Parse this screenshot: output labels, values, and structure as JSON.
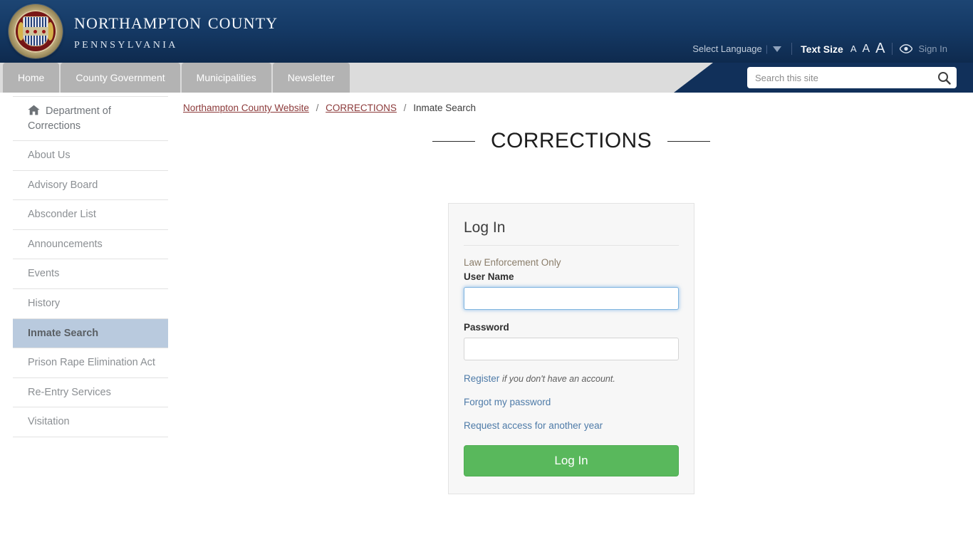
{
  "header": {
    "brand_line1": "Northampton County",
    "brand_line2": "Pennsylvania",
    "seal_alt": "county-seal",
    "select_language": "Select Language",
    "text_size_label": "Text Size",
    "text_size_small": "A",
    "text_size_medium": "A",
    "text_size_large": "A",
    "sign_in": "Sign In"
  },
  "nav": {
    "tabs": [
      {
        "label": "Home"
      },
      {
        "label": "County Government"
      },
      {
        "label": "Municipalities"
      },
      {
        "label": "Newsletter"
      }
    ],
    "search_placeholder": "Search this site",
    "search_value": ""
  },
  "breadcrumb": {
    "items": [
      {
        "label": "Northampton County Website",
        "link": true
      },
      {
        "label": "CORRECTIONS",
        "link": true
      },
      {
        "label": "Inmate Search",
        "link": false
      }
    ],
    "separator": "/"
  },
  "page": {
    "title": "CORRECTIONS"
  },
  "sidebar": {
    "items": [
      {
        "label": "Department of Corrections",
        "icon": "home-icon",
        "active": false
      },
      {
        "label": "About Us",
        "active": false
      },
      {
        "label": "Advisory Board",
        "active": false
      },
      {
        "label": "Absconder List",
        "active": false
      },
      {
        "label": "Announcements",
        "active": false
      },
      {
        "label": "Events",
        "active": false
      },
      {
        "label": "History",
        "active": false
      },
      {
        "label": "Inmate Search",
        "active": true
      },
      {
        "label": "Prison Rape Elimination Act",
        "active": false
      },
      {
        "label": "Re-Entry Services",
        "active": false
      },
      {
        "label": "Visitation",
        "active": false
      }
    ]
  },
  "login": {
    "heading": "Log In",
    "notice": "Law Enforcement Only",
    "username_label": "User Name",
    "username_value": "",
    "password_label": "Password",
    "password_value": "",
    "register_link": "Register",
    "register_hint": "if you don't have an account.",
    "forgot_link": "Forgot my password",
    "request_link": "Request access for another year",
    "submit_label": "Log In"
  },
  "colors": {
    "header_blue": "#153a66",
    "nav_tab_gray": "#b3b3b3",
    "active_sidebar": "#b9cade",
    "link_red": "#8c3a3a",
    "link_blue": "#4e7ba8",
    "button_green": "#59b85c"
  }
}
